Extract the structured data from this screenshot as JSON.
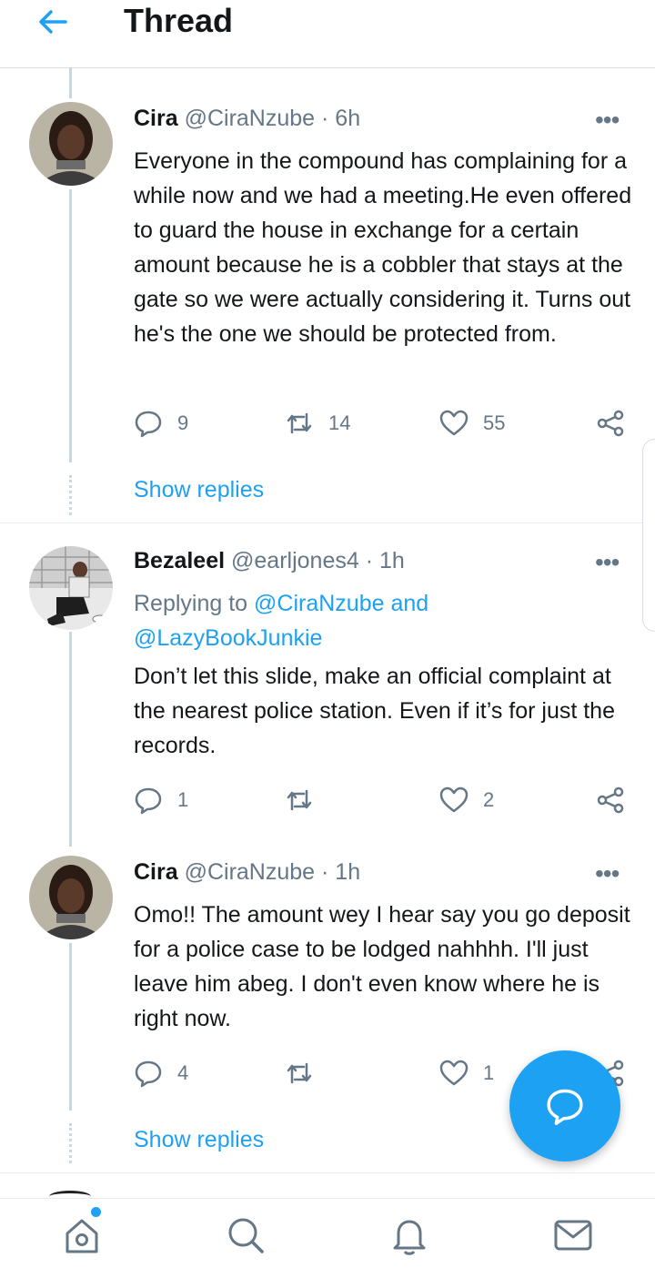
{
  "header": {
    "title": "Thread",
    "back_icon": "arrow-left-icon"
  },
  "colors": {
    "accent": "#1da1f2",
    "muted": "#657786",
    "text": "#14171a",
    "divider": "#e6ecf0"
  },
  "tweets": [
    {
      "name": "Cira",
      "handle": "@CiraNzube",
      "time": "· 6h",
      "text": "Everyone in the compound has complaining for a while now and we had a meeting.He even offered to guard the house in exchange for a certain amount because he is a cobbler that stays at the gate so we were actually considering it. Turns out he's the one we should be protected from.",
      "replies": "9",
      "retweets": "14",
      "likes": "55",
      "show_replies": "Show replies"
    },
    {
      "name": "Bezaleel",
      "handle": "@earljones4",
      "time": "· 1h",
      "replying_prefix": "Replying to ",
      "replying_mention_1": "@CiraNzube and",
      "replying_mention_2": "@LazyBookJunkie",
      "text": "Don’t let this slide, make an official complaint at the nearest police station. Even if it’s for just the records.",
      "replies": "1",
      "retweets": "",
      "likes": "2"
    },
    {
      "name": "Cira",
      "handle": "@CiraNzube",
      "time": "· 1h",
      "text": "Omo!! The amount wey I hear say you go deposit for a police case to be lodged nahhhh. I'll just leave him abeg. I don't even know where he is right now.",
      "replies": "4",
      "retweets": "",
      "likes": "1",
      "show_replies": "Show replies"
    }
  ],
  "more_glyph": "•••",
  "bottom_nav": [
    "home-icon",
    "search-icon",
    "notifications-icon",
    "messages-icon"
  ]
}
